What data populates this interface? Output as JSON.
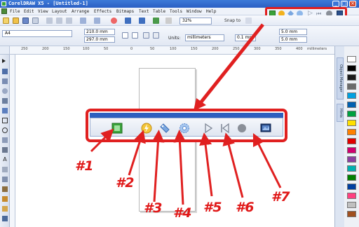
{
  "window": {
    "title": "CorelDRAW X5 - [Untitled-1]",
    "buttons": [
      "_",
      "□",
      "×"
    ]
  },
  "menu": [
    "File",
    "Edit",
    "View",
    "Layout",
    "Arrange",
    "Effects",
    "Bitmaps",
    "Text",
    "Table",
    "Tools",
    "Window",
    "Help"
  ],
  "toolbar": {
    "zoom": "32%",
    "snap_to": "Snap to"
  },
  "property_bar": {
    "paper": "A4",
    "width": "210.0 mm",
    "height": "297.0 mm",
    "units_label": "Units:",
    "units": "millimeters",
    "nudge": "0.1 mm",
    "dup_x": "5.0 mm",
    "dup_y": "5.0 mm"
  },
  "ruler": {
    "ticks": [
      "250",
      "200",
      "150",
      "100",
      "50",
      "0",
      "50",
      "100",
      "150",
      "200",
      "250",
      "300",
      "350",
      "400"
    ],
    "unit": "millimeters"
  },
  "dockers": [
    "Object Manager",
    "Hints"
  ],
  "palette_colors": [
    "#ffffff",
    "#000000",
    "#1a1a1a",
    "#6b6b6b",
    "#00a0e0",
    "#0060b0",
    "#00a040",
    "#ffe000",
    "#ff8000",
    "#e00000",
    "#d0006f",
    "#8b3fa0",
    "#00b0b0",
    "#008000",
    "#003f9f",
    "#ff4080",
    "#c0c0c0",
    "#a05020"
  ],
  "macro_toolbar": {
    "buttons": [
      {
        "name": "run-macro",
        "icon": "macro-manager-icon"
      },
      {
        "name": "macro-editor",
        "icon": "lightning-icon"
      },
      {
        "name": "vba-editor",
        "icon": "edit-tag-icon"
      },
      {
        "name": "macro-options",
        "icon": "gear-icon"
      },
      {
        "name": "run",
        "icon": "play-icon"
      },
      {
        "name": "stop",
        "icon": "rewind-icon"
      },
      {
        "name": "record",
        "icon": "record-icon"
      },
      {
        "name": "add-in",
        "icon": "monitor-icon"
      }
    ]
  },
  "callout_labels": [
    "#1",
    "#2",
    "#3",
    "#4",
    "#5",
    "#6",
    "#7"
  ],
  "accent": "#e02020"
}
